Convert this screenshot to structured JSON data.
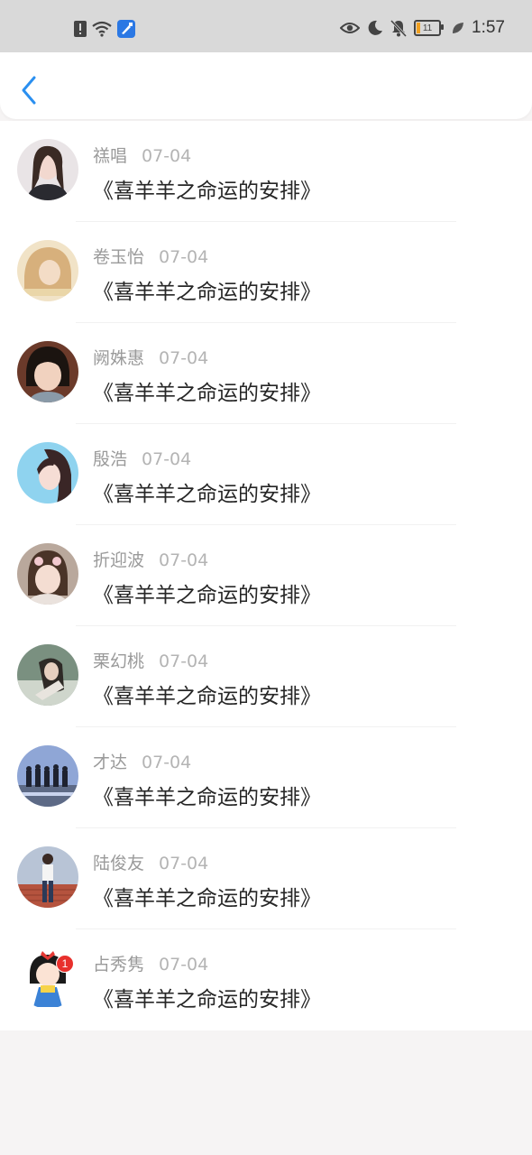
{
  "status_bar": {
    "time": "1:57",
    "battery_level": "11",
    "icons": [
      "alert-icon",
      "wifi-icon",
      "cleaner-app-icon",
      "eye-icon",
      "moon-icon",
      "bell-off-icon",
      "battery-icon",
      "leaf-icon"
    ]
  },
  "header": {
    "back_icon": "chevron-left-icon",
    "accent_color": "#2a8ff0"
  },
  "items": [
    {
      "name": "禚唱",
      "date": "07-04",
      "title": "《喜羊羊之命运的安排》"
    },
    {
      "name": "卷玉怡",
      "date": "07-04",
      "title": "《喜羊羊之命运的安排》"
    },
    {
      "name": "阙姝惠",
      "date": "07-04",
      "title": "《喜羊羊之命运的安排》"
    },
    {
      "name": "殷浩",
      "date": "07-04",
      "title": "《喜羊羊之命运的安排》"
    },
    {
      "name": "折迎波",
      "date": "07-04",
      "title": "《喜羊羊之命运的安排》"
    },
    {
      "name": "栗幻桃",
      "date": "07-04",
      "title": "《喜羊羊之命运的安排》"
    },
    {
      "name": "才达",
      "date": "07-04",
      "title": "《喜羊羊之命运的安排》"
    },
    {
      "name": "陆俊友",
      "date": "07-04",
      "title": "《喜羊羊之命运的安排》"
    },
    {
      "name": "占秀隽",
      "date": "07-04",
      "title": "《喜羊羊之命运的安排》"
    }
  ],
  "last_avatar_badge": "1"
}
